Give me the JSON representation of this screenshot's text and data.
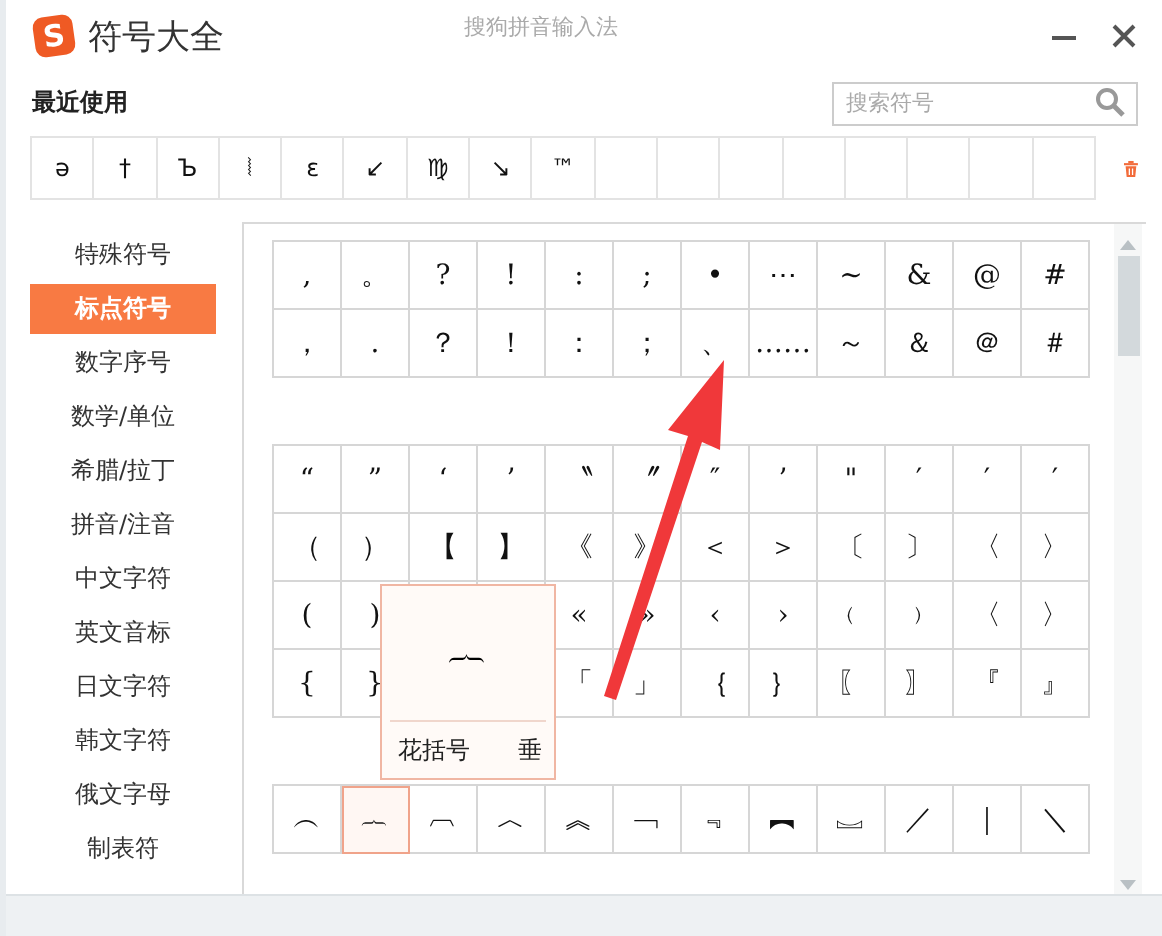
{
  "window": {
    "logo_text": "S",
    "title": "符号大全",
    "subtitle": "搜狗拼音输入法"
  },
  "recent": {
    "label": "最近使用",
    "search": {
      "placeholder": "搜索符号"
    },
    "symbols": [
      "ə",
      "†",
      "Ъ",
      "⦚",
      "ɛ",
      "↙",
      "♍",
      "↘",
      "™"
    ]
  },
  "sidebar": {
    "items": [
      {
        "label": "特殊符号",
        "selected": false
      },
      {
        "label": "标点符号",
        "selected": true
      },
      {
        "label": "数字序号",
        "selected": false
      },
      {
        "label": "数学/单位",
        "selected": false
      },
      {
        "label": "希腊/拉丁",
        "selected": false
      },
      {
        "label": "拼音/注音",
        "selected": false
      },
      {
        "label": "中文字符",
        "selected": false
      },
      {
        "label": "英文音标",
        "selected": false
      },
      {
        "label": "日文字符",
        "selected": false
      },
      {
        "label": "韩文字符",
        "selected": false
      },
      {
        "label": "俄文字母",
        "selected": false
      },
      {
        "label": "制表符",
        "selected": false
      }
    ]
  },
  "groups": [
    {
      "rows": [
        [
          {
            "char": ",",
            "selected": false
          },
          {
            "char": "。",
            "selected": false
          },
          {
            "char": "?",
            "selected": false
          },
          {
            "char": "!",
            "selected": false
          },
          {
            "char": ":",
            "selected": false
          },
          {
            "char": ";",
            "selected": false
          },
          {
            "char": "•",
            "selected": false
          },
          {
            "char": "⋯",
            "selected": false
          },
          {
            "char": "~",
            "selected": false
          },
          {
            "char": "&",
            "selected": false
          },
          {
            "char": "@",
            "selected": false
          },
          {
            "char": "#",
            "selected": false
          }
        ],
        [
          {
            "char": "，",
            "selected": false
          },
          {
            "char": ".",
            "selected": false
          },
          {
            "char": "？",
            "selected": false
          },
          {
            "char": "！",
            "selected": false
          },
          {
            "char": "：",
            "selected": false
          },
          {
            "char": "；",
            "selected": false
          },
          {
            "char": "、",
            "selected": false
          },
          {
            "char": "……",
            "selected": false
          },
          {
            "char": "～",
            "selected": false
          },
          {
            "char": "＆",
            "selected": false
          },
          {
            "char": "＠",
            "selected": false
          },
          {
            "char": "＃",
            "selected": false
          }
        ]
      ]
    },
    {
      "rows": [
        [
          {
            "char": "“",
            "selected": false
          },
          {
            "char": "”",
            "selected": false
          },
          {
            "char": "‘",
            "selected": false
          },
          {
            "char": "’",
            "selected": false
          },
          {
            "char": "〝",
            "selected": false
          },
          {
            "char": "〞",
            "selected": false
          },
          {
            "char": "″",
            "selected": false
          },
          {
            "char": "’",
            "selected": false
          },
          {
            "char": "\"",
            "selected": false
          },
          {
            "char": "′",
            "selected": false
          },
          {
            "char": "′",
            "selected": false
          },
          {
            "char": "′",
            "selected": false
          }
        ],
        [
          {
            "char": "（",
            "selected": false
          },
          {
            "char": "）",
            "selected": false
          },
          {
            "char": "【",
            "selected": false
          },
          {
            "char": "】",
            "selected": false
          },
          {
            "char": "《",
            "selected": false
          },
          {
            "char": "》",
            "selected": false
          },
          {
            "char": "＜",
            "selected": false
          },
          {
            "char": "＞",
            "selected": false
          },
          {
            "char": "〔",
            "selected": false
          },
          {
            "char": "〕",
            "selected": false
          },
          {
            "char": "〈",
            "selected": false
          },
          {
            "char": "〉",
            "selected": false
          }
        ],
        [
          {
            "char": "(",
            "selected": false
          },
          {
            "char": ")",
            "selected": false
          },
          null,
          null,
          {
            "char": "«",
            "selected": false
          },
          {
            "char": "»",
            "selected": false
          },
          {
            "char": "‹",
            "selected": false
          },
          {
            "char": "›",
            "selected": false
          },
          {
            "char": "﹙",
            "selected": false
          },
          {
            "char": "﹚",
            "selected": false
          },
          {
            "char": "〈",
            "selected": false
          },
          {
            "char": "〉",
            "selected": false
          }
        ],
        [
          {
            "char": "{",
            "selected": false
          },
          {
            "char": "}",
            "selected": false
          },
          null,
          null,
          {
            "char": "「",
            "selected": false
          },
          {
            "char": "」",
            "selected": false
          },
          {
            "char": "｛",
            "selected": false
          },
          {
            "char": "｝",
            "selected": false
          },
          {
            "char": "〖",
            "selected": false
          },
          {
            "char": "〗",
            "selected": false
          },
          {
            "char": "『",
            "selected": false
          },
          {
            "char": "』",
            "selected": false
          }
        ]
      ]
    },
    {
      "rows": [
        [
          {
            "char": "︵",
            "selected": false
          },
          {
            "char": "︷",
            "selected": true
          },
          {
            "char": "︹",
            "selected": false
          },
          {
            "char": "︿",
            "selected": false
          },
          {
            "char": "︽",
            "selected": false
          },
          {
            "char": "﹁",
            "selected": false
          },
          {
            "char": "﹃",
            "selected": false
          },
          {
            "char": "︻",
            "selected": false
          },
          {
            "char": "︗",
            "selected": false
          },
          {
            "char": "／",
            "selected": false
          },
          {
            "char": "｜",
            "selected": false
          },
          {
            "char": "＼",
            "selected": false
          }
        ]
      ]
    }
  ],
  "tooltip": {
    "symbol": "︷",
    "name": "花括号",
    "extra": "垂"
  }
}
